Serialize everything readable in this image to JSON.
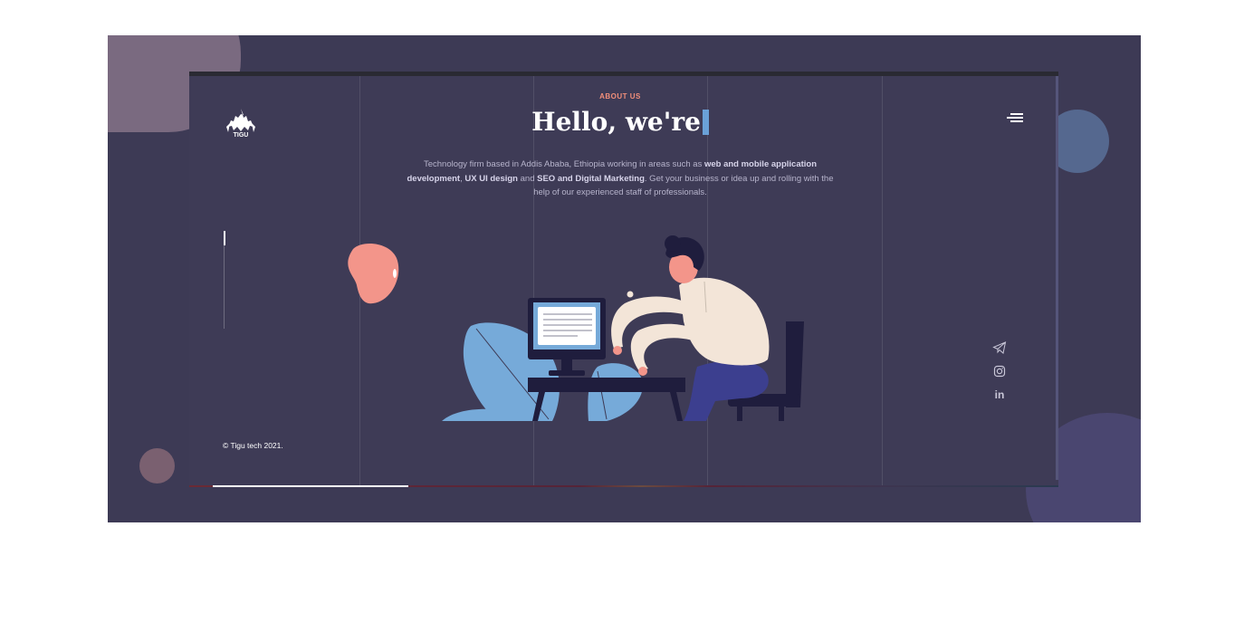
{
  "brand": {
    "logo_text": "TIGU"
  },
  "hero": {
    "kicker": "ABOUT US",
    "title": "Hello, we're",
    "desc_1": "Technology firm based in Addis Ababa, Ethiopia working in areas such as ",
    "desc_b1": "web and mobile application development",
    "desc_2": ", ",
    "desc_b2": "UX UI design",
    "desc_3": " and ",
    "desc_b3": "SEO and Digital Marketing",
    "desc_4": ". Get your business or idea up and rolling with the help of our experienced staff of professionals."
  },
  "footer": {
    "copyright": "© Tigu tech 2021."
  },
  "socials": [
    "telegram-icon",
    "instagram-icon",
    "linkedin-icon"
  ],
  "linkedin_label": "in",
  "progress": {
    "value_fraction": 0.23
  },
  "colors": {
    "accent": "#f28f7a",
    "cursor": "#6aa1d8",
    "background": "#3d3a55"
  }
}
